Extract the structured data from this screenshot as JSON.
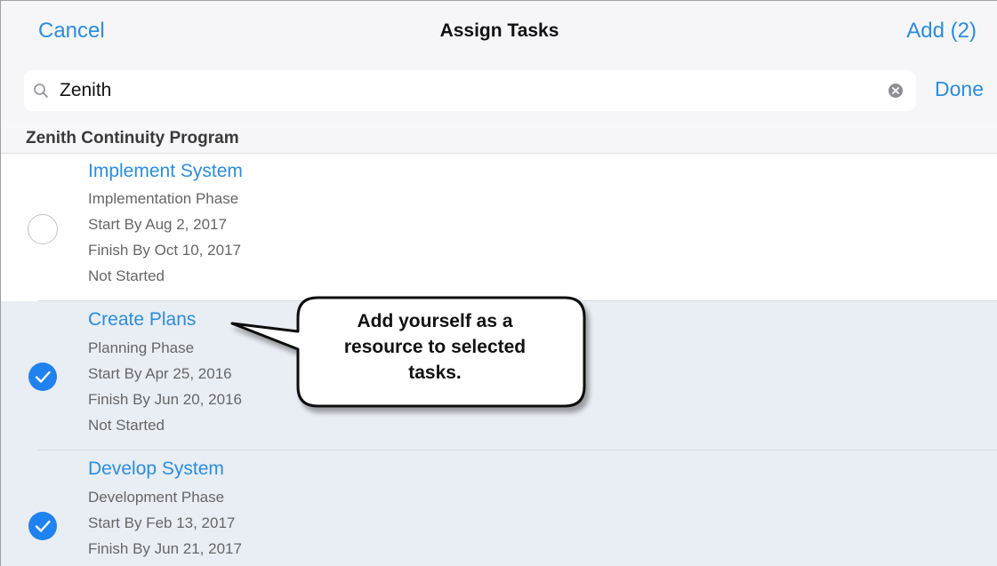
{
  "navbar": {
    "cancel_label": "Cancel",
    "title": "Assign Tasks",
    "add_label": "Add (2)"
  },
  "search": {
    "value": "Zenith",
    "done_label": "Done"
  },
  "section": {
    "title": "Zenith Continuity Program"
  },
  "tasks": [
    {
      "title": "Implement System",
      "phase": "Implementation Phase",
      "start": "Start By Aug 2, 2017",
      "finish": "Finish By Oct 10, 2017",
      "status": "Not Started",
      "selected": false
    },
    {
      "title": "Create Plans",
      "phase": "Planning Phase",
      "start": "Start By Apr 25, 2016",
      "finish": "Finish By Jun 20, 2016",
      "status": "Not Started",
      "selected": true
    },
    {
      "title": "Develop System",
      "phase": "Development Phase",
      "start": "Start By Feb 13, 2017",
      "finish": "Finish By Jun 21, 2017",
      "selected": true
    }
  ],
  "callout": {
    "line1": "Add yourself as a",
    "line2": "resource to selected",
    "line3": "tasks."
  },
  "colors": {
    "accent": "#2a8de0",
    "selected_row": "#e9edf4",
    "check_fill": "#1f82f0"
  },
  "icons": {
    "search": "search-icon",
    "clear": "clear-search-icon",
    "checked": "checkmark-circle-icon",
    "unchecked": "empty-circle-icon"
  }
}
